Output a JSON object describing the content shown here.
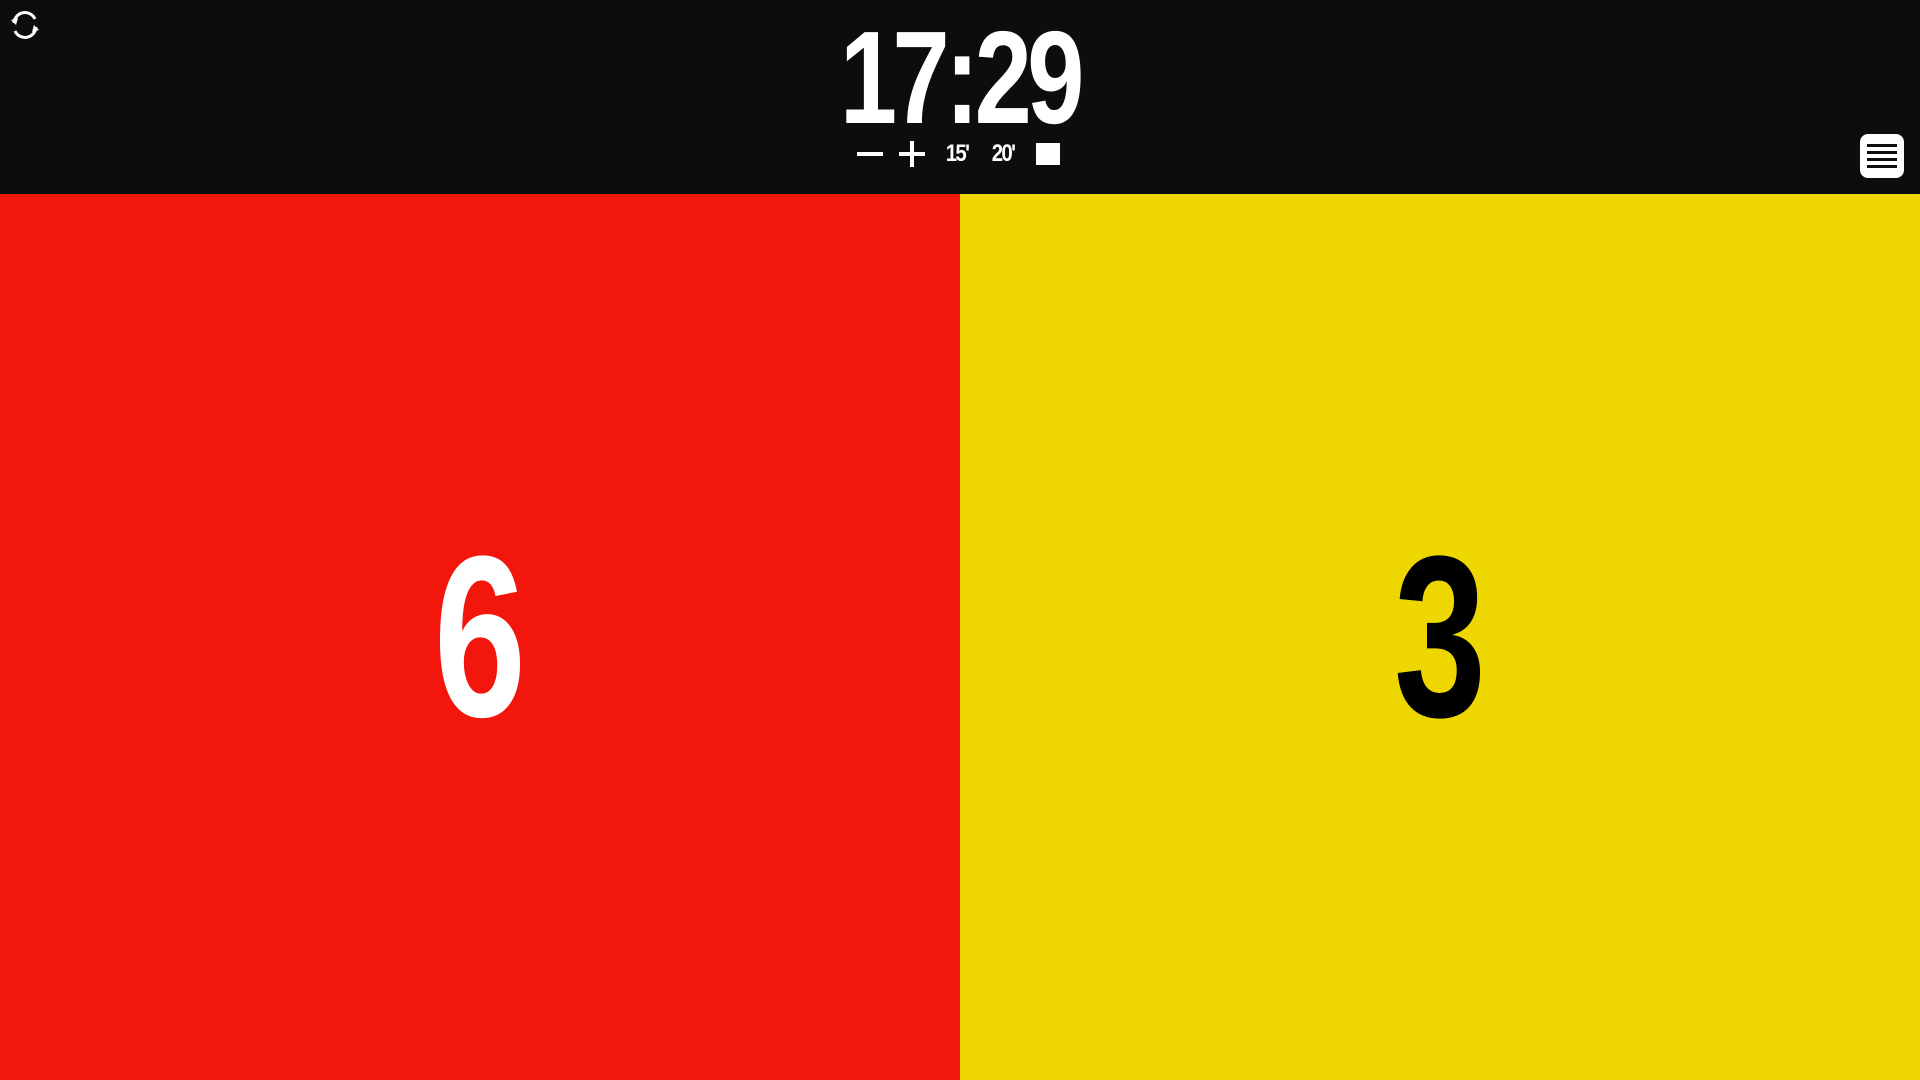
{
  "timer": {
    "display": "17:29",
    "controls": {
      "minus_label": "−",
      "plus_label": "+",
      "preset_15_label": "15'",
      "preset_20_label": "20'"
    }
  },
  "teams": [
    {
      "side": "left",
      "score": "6",
      "background": "#f2160d",
      "text_color": "#ffffff"
    },
    {
      "side": "right",
      "score": "3",
      "background": "#eed700",
      "text_color": "#000000"
    }
  ],
  "icons": {
    "swap": "swap-sides-icon",
    "menu": "menu-icon",
    "stop": "stop-icon"
  }
}
